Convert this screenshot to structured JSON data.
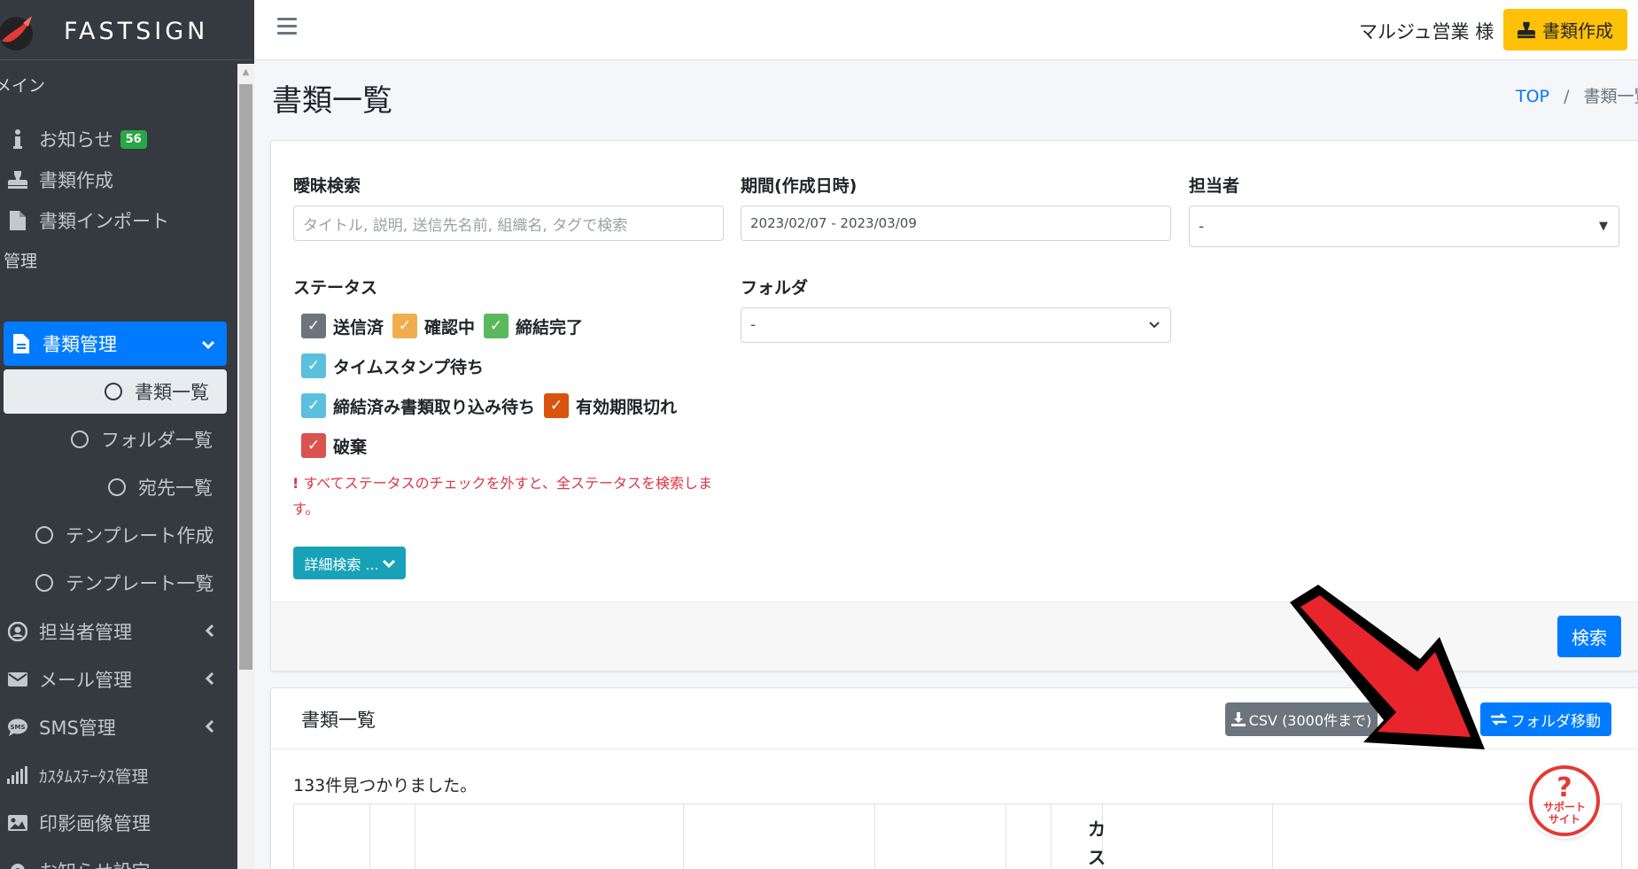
{
  "brand": {
    "name": "FASTSIGN"
  },
  "topbar": {
    "user": "マルジュ営業 様",
    "create_button": "書類作成"
  },
  "sidebar": {
    "section_main": "メイン",
    "section_manage": "管理",
    "items": [
      {
        "label": "お知らせ",
        "badge": "56",
        "icon": "info-icon"
      },
      {
        "label": "書類作成",
        "icon": "stamp-icon"
      },
      {
        "label": "書類インポート",
        "icon": "file-icon"
      },
      {
        "label": "書類管理",
        "icon": "file-icon"
      },
      {
        "label": "書類一覧"
      },
      {
        "label": "フォルダ一覧"
      },
      {
        "label": "宛先一覧"
      },
      {
        "label": "テンプレート作成"
      },
      {
        "label": "テンプレート一覧"
      },
      {
        "label": "担当者管理",
        "icon": "user-circle-icon"
      },
      {
        "label": "メール管理",
        "icon": "envelope-icon"
      },
      {
        "label": "SMS管理",
        "icon": "sms-icon"
      },
      {
        "label": "ｶｽﾀﾑｽﾃｰﾀｽ管理",
        "icon": "signal-icon"
      },
      {
        "label": "印影画像管理",
        "icon": "image-icon"
      },
      {
        "label": "お知らせ設定",
        "icon": "gear-icon"
      }
    ]
  },
  "page": {
    "title": "書類一覧",
    "breadcrumb_top": "TOP",
    "breadcrumb_current": "書類一覧"
  },
  "search": {
    "fuzzy_label": "曖昧検索",
    "fuzzy_placeholder": "タイトル, 説明, 送信先名前, 組織名, タグで検索",
    "period_label": "期間(作成日時)",
    "period_value": "2023/02/07 - 2023/03/09",
    "assignee_label": "担当者",
    "assignee_value": "-",
    "status_label": "ステータス",
    "folder_label": "フォルダ",
    "folder_value": "-",
    "statuses": [
      {
        "label": "送信済",
        "color": "#6c757d"
      },
      {
        "label": "確認中",
        "color": "#f0ad4e"
      },
      {
        "label": "締結完了",
        "color": "#5cb85c"
      },
      {
        "label": "タイムスタンプ待ち",
        "color": "#5bc0de"
      },
      {
        "label": "締結済み書類取り込み待ち",
        "color": "#5bc0de"
      },
      {
        "label": "有効期限切れ",
        "color": "#d9530f"
      },
      {
        "label": "破棄",
        "color": "#d9534f"
      }
    ],
    "warning": "すべてステータスのチェックを外すと、全ステータスを検索します。",
    "detail_button": "詳細検索 ...",
    "search_button": "検索"
  },
  "list": {
    "title": "書類一覧",
    "csv_button": "CSV (3000件まで)",
    "folder_move_button": "フォルダ移動",
    "found_text": "133件見つかりました。",
    "column_partial": "カス"
  },
  "support": {
    "line1": "サポート",
    "line2": "サイト"
  },
  "colors": {
    "primary": "#007bff",
    "warning": "#ffc107",
    "sidebar": "#343a40",
    "info": "#17a2b8"
  }
}
